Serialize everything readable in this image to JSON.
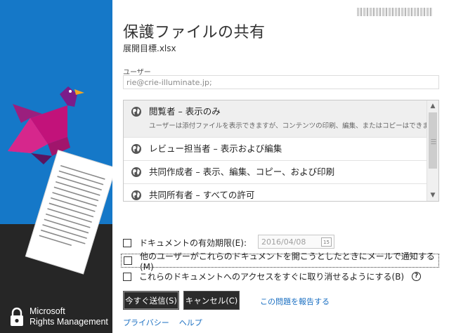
{
  "brand": {
    "line1": "Microsoft",
    "line2": "Rights Management"
  },
  "dialog": {
    "title": "保護ファイルの共有",
    "filename": "展開目標.xlsx"
  },
  "user": {
    "label": "ユーザー",
    "value": "rie@crie-illuminate.jp;"
  },
  "permissions": [
    {
      "icon": "globe-icon",
      "title": "閲覧者 – 表示のみ",
      "description": "ユーザーは添付ファイルを表示できますが、コンテンツの印刷、編集、またはコピーはできませ",
      "selected": true
    },
    {
      "icon": "globe-icon",
      "title": "レビュー担当者 – 表示および編集",
      "selected": false
    },
    {
      "icon": "globe-icon",
      "title": "共同作成者 – 表示、編集、コピー、および印刷",
      "selected": false
    },
    {
      "icon": "globe-icon",
      "title": "共同所有者 – すべての許可",
      "selected": false
    }
  ],
  "options": {
    "expiry_label": "ドキュメントの有効期限(E):",
    "expiry_date": "2016/04/08",
    "calendar_day": "15",
    "notify_label": "他のユーザーがこれらのドキュメントを開こうとしたときにメールで通知する(M)",
    "revoke_label": "これらのドキュメントへのアクセスをすぐに取り消せるようにする(B)",
    "help_symbol": "?"
  },
  "buttons": {
    "send": "今すぐ送信(S)",
    "cancel": "キャンセル(C)",
    "report": "この問題を報告する"
  },
  "footer": {
    "privacy": "プライバシー",
    "help": "ヘルプ"
  },
  "colors": {
    "brand_blue": "#1578c8",
    "dark_panel": "#262626",
    "link": "#1a6fc2",
    "button": "#2b2b2b"
  }
}
